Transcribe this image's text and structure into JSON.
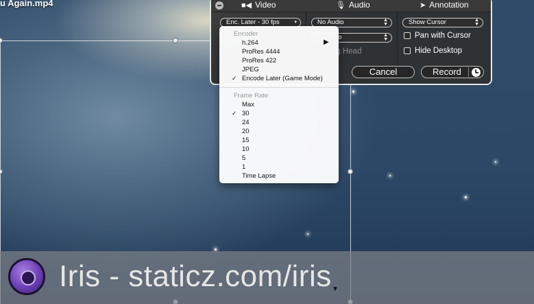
{
  "video": {
    "filename": "u Again.mp4"
  },
  "panel": {
    "tabs": [
      {
        "label": "Video",
        "icon": "video-camera-icon"
      },
      {
        "label": "Audio",
        "icon": "microphone-icon"
      },
      {
        "label": "Annotation",
        "icon": "cursor-icon"
      }
    ],
    "video_format_value": "Enc. Later - 30 fps",
    "audio_source_value": "No Audio",
    "audio_secondary_partial": "io",
    "ghost_label_partial": "ng Head",
    "cursor_value": "Show Cursor",
    "pan_with_cursor_label": "Pan with Cursor",
    "hide_desktop_label": "Hide Desktop",
    "cancel_label": "Cancel",
    "record_label": "Record"
  },
  "menu": {
    "encoder_header": "Encoder",
    "encoder_items": [
      {
        "label": "h.264",
        "checked": false,
        "submenu": true
      },
      {
        "label": "ProRes 4444",
        "checked": false,
        "submenu": false
      },
      {
        "label": "ProRes 422",
        "checked": false,
        "submenu": false
      },
      {
        "label": "JPEG",
        "checked": false,
        "submenu": false
      },
      {
        "label": "Encode Later (Game Mode)",
        "checked": true,
        "submenu": false
      }
    ],
    "framerate_header": "Frame Rate",
    "framerate_items": [
      {
        "label": "Max",
        "checked": false
      },
      {
        "label": "30",
        "checked": true
      },
      {
        "label": "24",
        "checked": false
      },
      {
        "label": "20",
        "checked": false
      },
      {
        "label": "15",
        "checked": false
      },
      {
        "label": "10",
        "checked": false
      },
      {
        "label": "5",
        "checked": false
      },
      {
        "label": "1",
        "checked": false
      },
      {
        "label": "Time Lapse",
        "checked": false
      }
    ],
    "check_glyph": "✓",
    "submenu_glyph": "▶"
  },
  "banner": {
    "text": "Iris - staticz.com/iris"
  },
  "colors": {
    "panel_bg": "#303030",
    "panel_border": "#e6e6e6",
    "menu_bg": "#fcfcfc",
    "banner_bg": "#7d8086",
    "logo_purple": "#6b3fb4"
  }
}
